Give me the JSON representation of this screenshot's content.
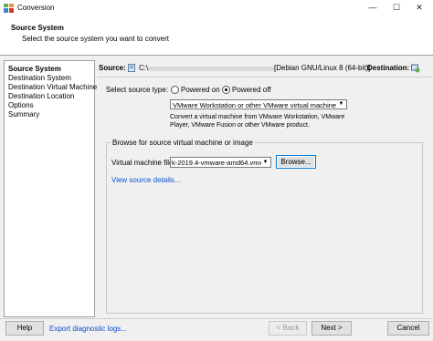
{
  "window": {
    "title": "Conversion",
    "minimize_icon": "minimize-icon",
    "maximize_icon": "maximize-icon",
    "close_icon": "close-icon"
  },
  "header": {
    "title": "Source System",
    "subtitle": "Select the source system you want to convert"
  },
  "nav": {
    "items": [
      {
        "label": "Source System",
        "active": true
      },
      {
        "label": "Destination System",
        "active": false
      },
      {
        "label": "Destination Virtual Machine",
        "active": false
      },
      {
        "label": "Destination Location",
        "active": false
      },
      {
        "label": "Options",
        "active": false
      },
      {
        "label": "Summary",
        "active": false
      }
    ]
  },
  "source_line": {
    "source_label": "Source:",
    "source_path": "C:\\",
    "source_os": "[Debian GNU/Linux 8 (64-bit)]",
    "destination_label": "Destination:"
  },
  "source_type": {
    "label": "Select source type:",
    "options": [
      {
        "label": "Powered on",
        "selected": false
      },
      {
        "label": "Powered off",
        "selected": true
      }
    ],
    "selected_value": "VMware Workstation or other VMware virtual machine",
    "description": "Convert a virtual machine from VMware Workstation, VMware Player, VMware Fusion or other VMware product."
  },
  "browse_group": {
    "title": "Browse for source virtual machine or image",
    "vm_file_label": "Virtual machine file:",
    "vm_file_value": "k-2019.4-vmware-amd64.vmx",
    "browse_label": "Browse...",
    "details_link": "View source details..."
  },
  "footer": {
    "help_label": "Help",
    "diag_link": "Export diagnostic logs...",
    "back_label": "< Back",
    "next_label": "Next >",
    "cancel_label": "Cancel"
  },
  "colors": {
    "link": "#0b4fd6",
    "window_bg": "#f0f0f0",
    "panel_bg": "#ffffff",
    "focus_border": "#0078d7"
  }
}
